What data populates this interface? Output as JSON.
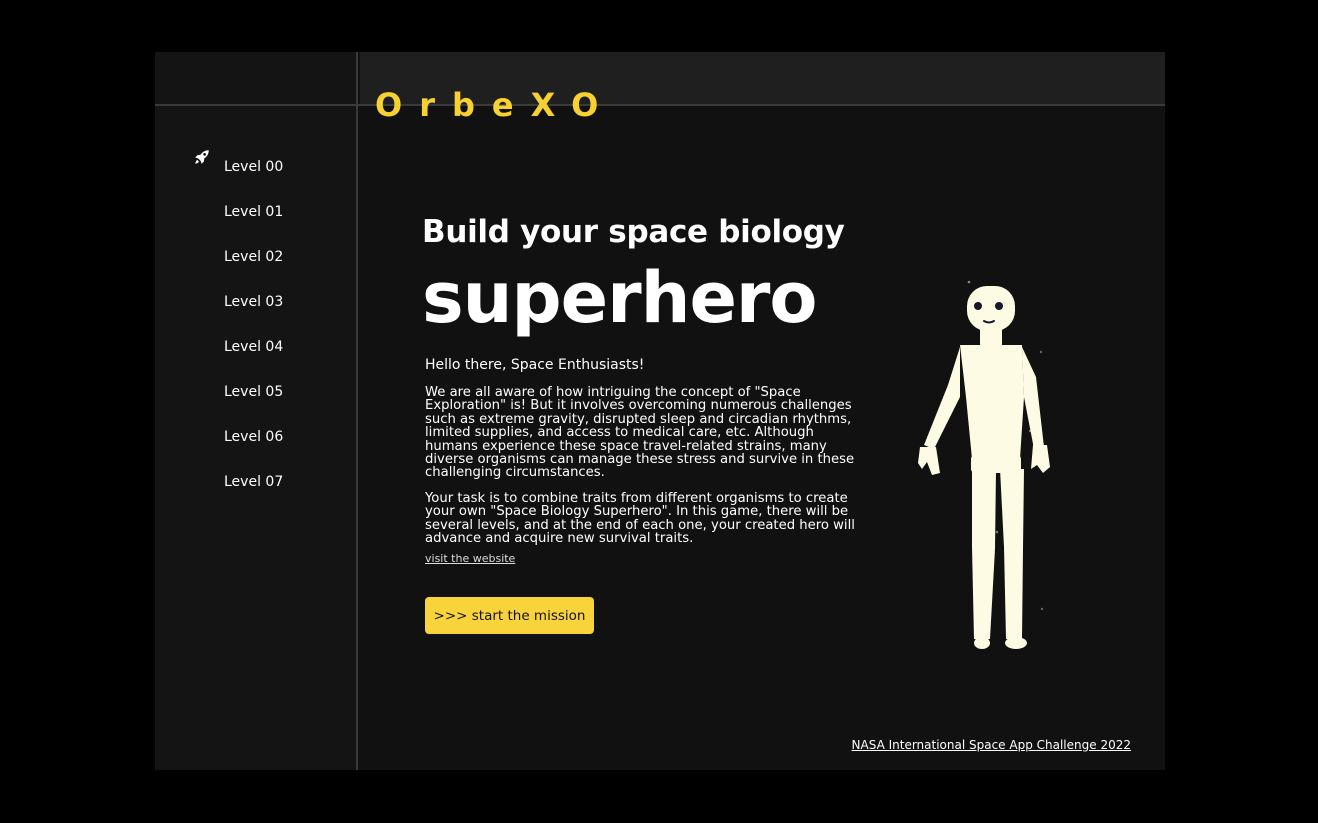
{
  "app": {
    "logo": "OrbeXO"
  },
  "sidebar": {
    "items": [
      {
        "label": "Level 00",
        "active": true
      },
      {
        "label": "Level 01"
      },
      {
        "label": "Level 02"
      },
      {
        "label": "Level 03"
      },
      {
        "label": "Level 04"
      },
      {
        "label": "Level 05"
      },
      {
        "label": "Level 06"
      },
      {
        "label": "Level 07"
      }
    ]
  },
  "hero": {
    "headline_line1": "Build your space biology",
    "headline_line2": "superhero",
    "greeting": "Hello there, Space Enthusiasts!",
    "paragraph1": "We are all aware of how intriguing the concept of \"Space Exploration\" is! But it involves overcoming numerous challenges such as extreme gravity, disrupted sleep and circadian rhythms, limited supplies, and access to medical care, etc. Although humans experience these space travel-related strains, many diverse organisms can manage these stress and survive in these challenging circumstances.",
    "paragraph2": "Your task is to combine traits from different organisms to create your own \"Space Biology Superhero\". In this game, there will be several levels, and at the end of each one, your created hero will advance and acquire new survival traits.",
    "visit_link": "visit the website",
    "cta_label": ">>> start the mission"
  },
  "footer": {
    "link": "NASA International Space App Challenge 2022"
  },
  "colors": {
    "accent": "#f7d031",
    "background": "#111111",
    "figure": "#fdfbe3"
  },
  "icons": {
    "active_level": "rocket-icon"
  }
}
